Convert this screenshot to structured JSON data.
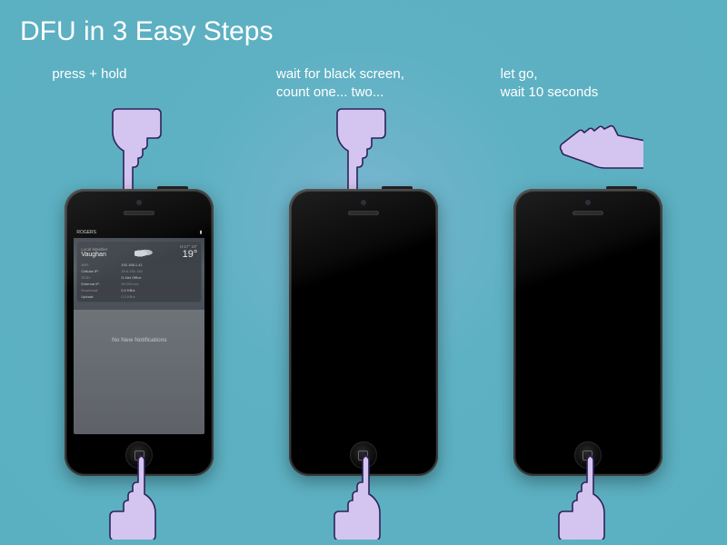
{
  "title": "DFU in 3 Easy Steps",
  "steps": [
    {
      "instruction": "press + hold"
    },
    {
      "instruction": "wait for black screen,\ncount one... two..."
    },
    {
      "instruction": "let go,\nwait 10 seconds"
    }
  ],
  "phone_screen": {
    "status": {
      "carrier": "ROGERS",
      "battery_icon": "battery"
    },
    "weather": {
      "label": "Local Weather",
      "location": "Vaughan",
      "hi": "H:17°",
      "lo": "19°",
      "temp": "19°"
    },
    "network": {
      "wifi_label": "WiFi:",
      "wifi_val": "192.168.1.41",
      "cell_label": "Cellular IP:",
      "cell_val": "25.6.250.146",
      "ssid_label": "SSID:",
      "ssid_val": "G-Net Office",
      "ext_label": "External IP:",
      "ext_val": "99.200.xxx",
      "down_label": "Download:",
      "down_val": "0.2 KB/s",
      "up_label": "Upload:",
      "up_val": "0.3 KB/s"
    },
    "notifications_empty": "No New Notifications"
  }
}
